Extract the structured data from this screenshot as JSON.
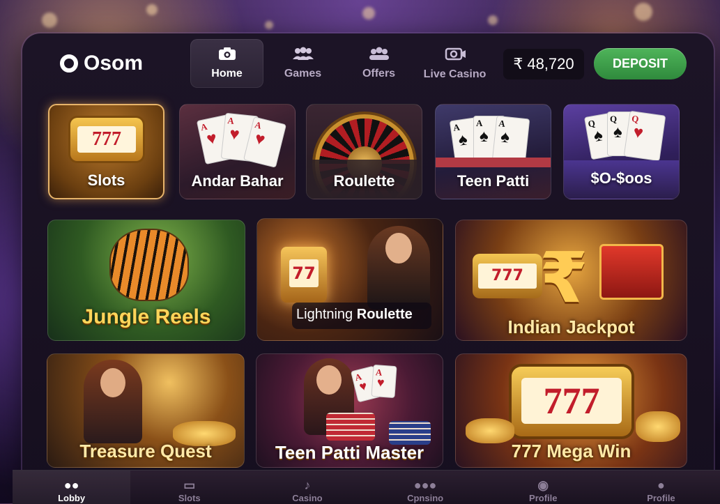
{
  "header": {
    "brand": "Osom",
    "nav": [
      {
        "label": "Home",
        "icon": "camera-icon"
      },
      {
        "label": "Games",
        "icon": "people-icon"
      },
      {
        "label": "Offers",
        "icon": "group-icon"
      },
      {
        "label": "Live Casino",
        "icon": "live-camera-icon"
      }
    ],
    "currency": "₹",
    "balance": "48,720",
    "deposit_label": "DEPOSIT"
  },
  "categories": [
    "Slots",
    "Andar Bahar",
    "Roulette",
    "Teen Patti",
    "$O-$oos"
  ],
  "games_row1": [
    "Jungle Reels",
    "Lightning",
    "Roulette",
    "Indian Jackpot"
  ],
  "games_row2": [
    "Treasure Quest",
    "Teen Patti Master",
    "777 Mega Win"
  ],
  "bottom_nav": [
    "Lobby",
    "Slots",
    "Casino",
    "Cpnsino",
    "Profile",
    "Profile"
  ],
  "colors": {
    "accent_green": "#3fa34d",
    "gold": "#e7b46a",
    "panel": "#1a1222"
  }
}
